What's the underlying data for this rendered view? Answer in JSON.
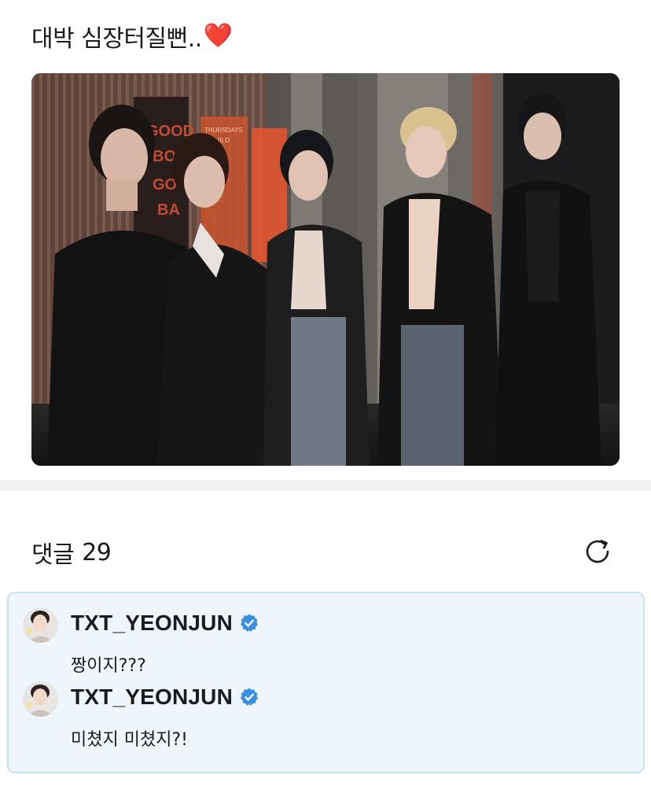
{
  "post": {
    "text": "대박 심장터질뻔..",
    "heart_emoji": "❤️",
    "image_alt": "Five members in black outfits posing against a wall"
  },
  "wall_sign": {
    "lines": [
      "GOOD",
      "BO",
      "GO",
      "BA"
    ],
    "orange_lines": [
      "THURSDAYS",
      "CHILD"
    ]
  },
  "comments_section": {
    "label": "댓글",
    "count": "29",
    "refresh_icon": "refresh-icon"
  },
  "comments": [
    {
      "author": "TXT_YEONJUN",
      "verified": true,
      "text": "짱이지???"
    },
    {
      "author": "TXT_YEONJUN",
      "verified": true,
      "text": "미쳤지 미쳤지?!"
    }
  ],
  "colors": {
    "accent_verified": "#3b8fe0",
    "comment_bg": "#eef6fc",
    "comment_border": "#c7e2f2",
    "heart": "#e0192b"
  }
}
